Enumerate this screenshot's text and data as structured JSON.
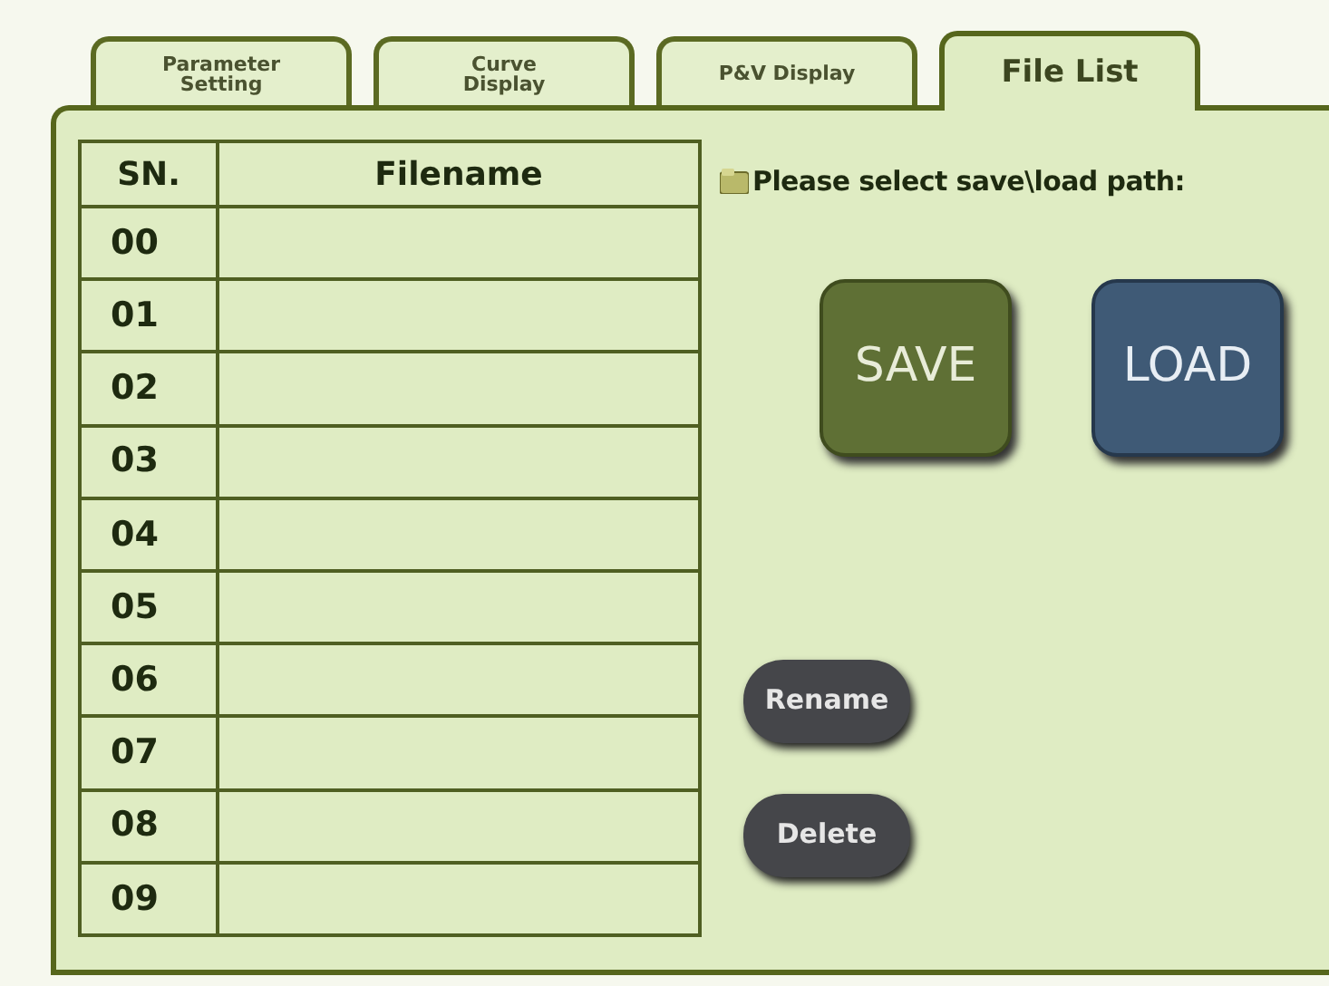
{
  "tabs": [
    {
      "label": "Parameter Setting",
      "selected": false
    },
    {
      "label": "Curve Display",
      "selected": false
    },
    {
      "label": "P&V Display",
      "selected": false
    },
    {
      "label": "File List",
      "selected": true
    }
  ],
  "table": {
    "columns": [
      "SN.",
      "Filename"
    ],
    "rows": [
      {
        "sn": "00"
      },
      {
        "sn": "01"
      },
      {
        "sn": "02"
      },
      {
        "sn": "03"
      },
      {
        "sn": "04"
      },
      {
        "sn": "05"
      },
      {
        "sn": "06"
      },
      {
        "sn": "07"
      },
      {
        "sn": "08"
      },
      {
        "sn": "09"
      }
    ]
  },
  "path_prompt": "Please select save\\load path:",
  "buttons": [
    {
      "label": "SAVE",
      "kind": "save"
    },
    {
      "label": "LOAD",
      "kind": "load"
    },
    {
      "label": "Rename",
      "kind": "small"
    },
    {
      "label": "Delete",
      "kind": "small"
    }
  ]
}
